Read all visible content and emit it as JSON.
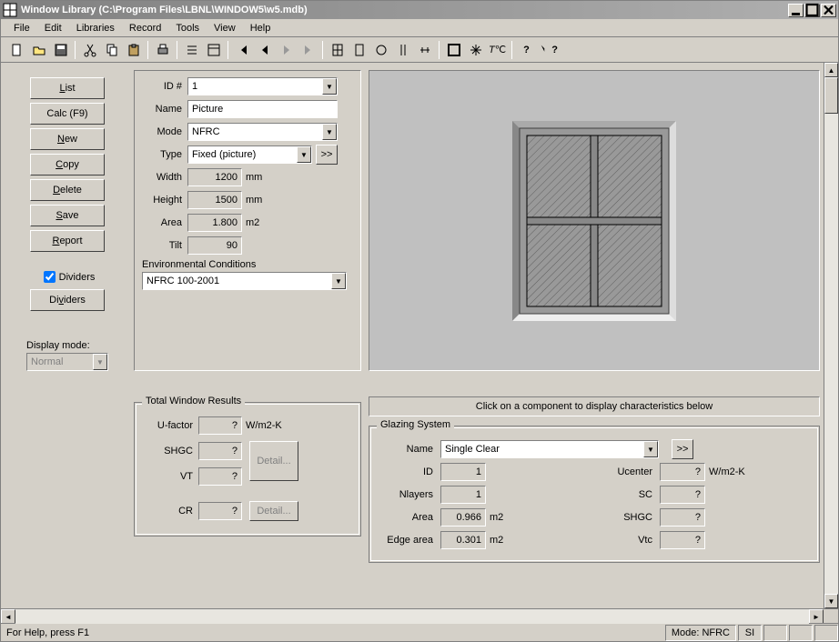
{
  "title": "Window Library  (C:\\Program Files\\LBNL\\WINDOW5\\w5.mdb)",
  "menu": [
    "File",
    "Edit",
    "Libraries",
    "Record",
    "Tools",
    "View",
    "Help"
  ],
  "buttons": {
    "list": "List",
    "calc": "Calc (F9)",
    "new": "New",
    "copy": "Copy",
    "delete": "Delete",
    "save": "Save",
    "report": "Report",
    "dividers_chk": "Dividers",
    "dividers_btn": "Dividers"
  },
  "display_mode": {
    "label": "Display mode:",
    "value": "Normal"
  },
  "form": {
    "id_lbl": "ID #",
    "id_val": "1",
    "name_lbl": "Name",
    "name_val": "Picture",
    "mode_lbl": "Mode",
    "mode_val": "NFRC",
    "type_lbl": "Type",
    "type_val": "Fixed (picture)",
    "type_more": ">>",
    "width_lbl": "Width",
    "width_val": "1200",
    "width_unit": "mm",
    "height_lbl": "Height",
    "height_val": "1500",
    "height_unit": "mm",
    "area_lbl": "Area",
    "area_val": "1.800",
    "area_unit": "m2",
    "tilt_lbl": "Tilt",
    "tilt_val": "90",
    "env_lbl": "Environmental Conditions",
    "env_val": "NFRC 100-2001"
  },
  "results": {
    "legend": "Total Window Results",
    "ufactor_lbl": "U-factor",
    "ufactor_val": "?",
    "ufactor_unit": "W/m2-K",
    "shgc_lbl": "SHGC",
    "shgc_val": "?",
    "vt_lbl": "VT",
    "vt_val": "?",
    "cr_lbl": "CR",
    "cr_val": "?",
    "detail_btn": "Detail..."
  },
  "click_hint": "Click on a component to display characteristics below",
  "glazing": {
    "legend": "Glazing System",
    "name_lbl": "Name",
    "name_val": "Single Clear",
    "more": ">>",
    "id_lbl": "ID",
    "id_val": "1",
    "nlayers_lbl": "Nlayers",
    "nlayers_val": "1",
    "area_lbl": "Area",
    "area_val": "0.966",
    "area_unit": "m2",
    "edge_lbl": "Edge area",
    "edge_val": "0.301",
    "edge_unit": "m2",
    "ucenter_lbl": "Ucenter",
    "ucenter_val": "?",
    "ucenter_unit": "W/m2-K",
    "sc_lbl": "SC",
    "sc_val": "?",
    "shgc_lbl": "SHGC",
    "shgc_val": "?",
    "vtc_lbl": "Vtc",
    "vtc_val": "?"
  },
  "status": {
    "help": "For Help, press F1",
    "mode": "Mode: NFRC",
    "unit": "SI"
  }
}
